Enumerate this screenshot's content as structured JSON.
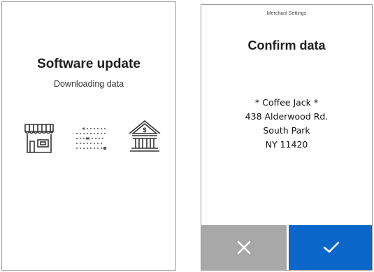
{
  "left_screen": {
    "title": "Software update",
    "subtitle": "Downloading data",
    "icons": [
      "shop-icon",
      "transfer-dots-icon",
      "bank-icon"
    ]
  },
  "right_screen": {
    "header": "Merchant Settings",
    "title": "Confirm data",
    "address": [
      "* Coffee Jack *",
      "438 Alderwood Rd.",
      "South Park",
      "NY 11420"
    ],
    "buttons": {
      "cancel": {
        "icon": "close-icon",
        "color": "#a8a8a8"
      },
      "confirm": {
        "icon": "check-icon",
        "color": "#0a66c8"
      }
    }
  }
}
